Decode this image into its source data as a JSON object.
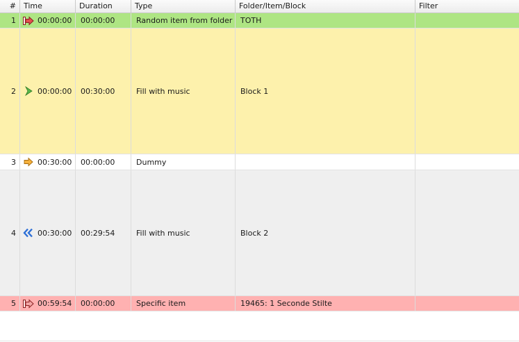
{
  "columns": {
    "num": "#",
    "time": "Time",
    "duration": "Duration",
    "type": "Type",
    "folder": "Folder/Item/Block",
    "filter": "Filter"
  },
  "rows": [
    {
      "num": "1",
      "time": "00:00:00",
      "duration": "00:00:00",
      "type": "Random item from folder",
      "folder": "TOTH",
      "filter": "",
      "icon": "random-item-icon",
      "color": "#aee583"
    },
    {
      "num": "2",
      "time": "00:00:00",
      "duration": "00:30:00",
      "type": "Fill with music",
      "folder": "Block 1",
      "filter": "",
      "icon": "play-arrow-icon",
      "color": "#fdf1ac"
    },
    {
      "num": "3",
      "time": "00:30:00",
      "duration": "00:00:00",
      "type": "Dummy",
      "folder": "",
      "filter": "",
      "icon": "orange-arrow-icon",
      "color": "#ffffff"
    },
    {
      "num": "4",
      "time": "00:30:00",
      "duration": "00:29:54",
      "type": "Fill with music",
      "folder": "Block 2",
      "filter": "",
      "icon": "double-chevron-left-icon",
      "color": "#efefef"
    },
    {
      "num": "5",
      "time": "00:59:54",
      "duration": "00:00:00",
      "type": "Specific item",
      "folder": "19465: 1 Seconde Stilte",
      "filter": "",
      "icon": "specific-item-icon",
      "color": "#ffb1b1"
    }
  ]
}
